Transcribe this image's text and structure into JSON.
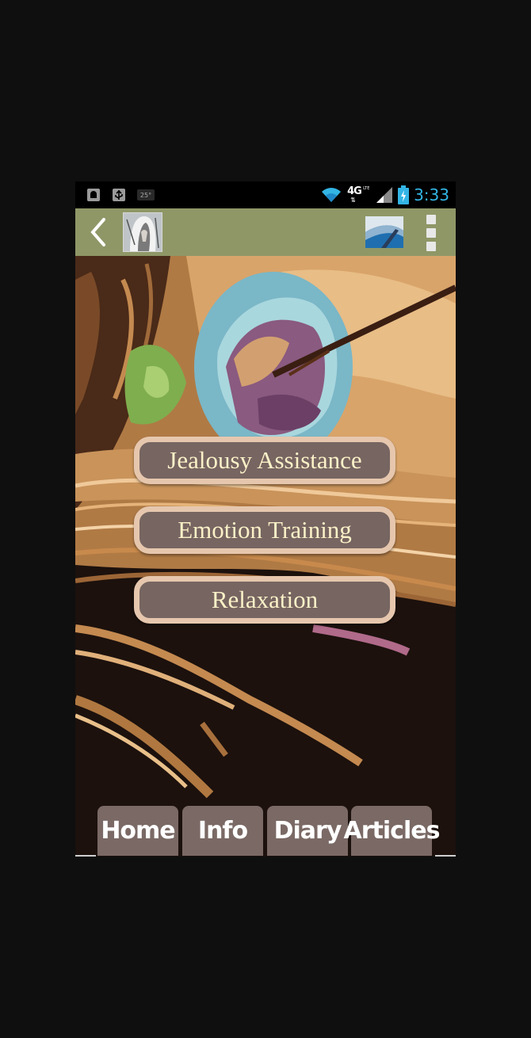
{
  "status_bar": {
    "time": "3:33",
    "network": "4G",
    "network_sub": "LTE",
    "notification_badge": "25°",
    "icons": [
      "android-debug-icon",
      "usb-icon",
      "weather-icon",
      "wifi-icon",
      "signal-icon",
      "battery-charging-icon"
    ]
  },
  "action_bar": {
    "back_icon": "chevron-left-icon",
    "app_icon": "app-avatar-icon",
    "logo_icon": "app-logo-icon",
    "overflow_icon": "overflow-menu-icon"
  },
  "menu": {
    "items": [
      {
        "label": "Jealousy Assistance"
      },
      {
        "label": "Emotion Training"
      },
      {
        "label": "Relaxation"
      }
    ]
  },
  "tabs": [
    {
      "label": "Home"
    },
    {
      "label": "Info"
    },
    {
      "label": "Diary"
    },
    {
      "label": "Articles"
    }
  ],
  "colors": {
    "action_bar": "#8f9767",
    "button_fill": "#766561",
    "button_border": "#e6c7ae",
    "button_text": "#fbf1c8",
    "tab_fill": "#7a6965",
    "clock": "#33b5e5"
  }
}
